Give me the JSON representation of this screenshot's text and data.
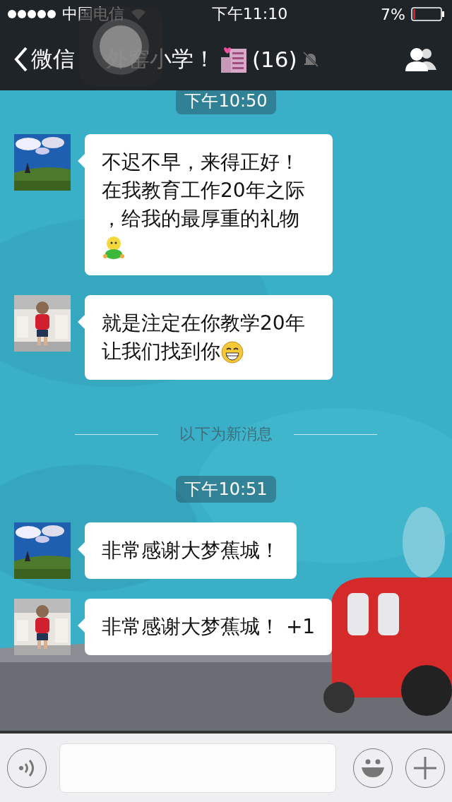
{
  "status_bar": {
    "carrier": "中国电信",
    "time": "下午11:10",
    "battery": "7%"
  },
  "nav_bar": {
    "back_label": "微信",
    "title": "外窑小学！",
    "member_count": "(16)",
    "muted": true
  },
  "chat": {
    "items": [
      {
        "kind": "time",
        "text": "下午10:50"
      },
      {
        "kind": "message",
        "avatar": {
          "kind": "landscape"
        },
        "text": "不迟不早，来得正好！在我教育工作20年之际，给我的最厚重的礼物",
        "emoji": {
          "kind": "figure"
        }
      },
      {
        "kind": "message",
        "avatar": {
          "kind": "child"
        },
        "text": "就是注定在你教学20年让我们找到你",
        "emoji": {
          "kind": "grin"
        }
      },
      {
        "kind": "divider",
        "text": "以下为新消息"
      },
      {
        "kind": "time",
        "text": "下午10:51"
      },
      {
        "kind": "message",
        "avatar": {
          "kind": "landscape"
        },
        "text": "非常感谢大梦蕉城！"
      },
      {
        "kind": "message",
        "avatar": {
          "kind": "child"
        },
        "text": "非常感谢大梦蕉城！ +1"
      }
    ]
  }
}
